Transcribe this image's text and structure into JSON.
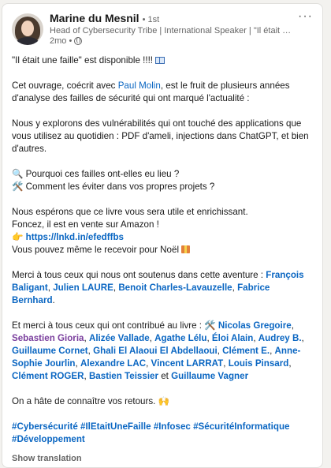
{
  "author": {
    "name": "Marine du Mesnil",
    "degree": "• 1st",
    "headline": "Head of Cybersecurity Tribe | International Speaker | \"Il était un...",
    "time": "2mo •"
  },
  "post": {
    "line1": "\"Il était une faille\" est disponible !!!! ",
    "p2_a": "Cet ouvrage, coécrit avec ",
    "p2_link": "Paul Molin",
    "p2_b": ", est le fruit de plusieurs années d'analyse des failles de sécurité qui ont marqué l'actualité :",
    "p3": "Nous y explorons des vulnérabilités qui ont touché des applications que vous utilisez au quotidien : PDF d'ameli, injections dans ChatGPT, et bien d'autres.",
    "q1": "🔍 Pourquoi ces failles ont-elles eu lieu ?",
    "q2": "🛠️ Comment les éviter dans vos propres projets ?",
    "p5_1": "Nous espérons que ce livre vous sera utile et enrichissant.",
    "p5_2": "Foncez, il est en vente sur Amazon !",
    "p5_url_prefix": "👉 ",
    "p5_url": "https://lnkd.in/efedffbs",
    "p5_3": "Vous pouvez même le recevoir pour Noël ",
    "thanks1_a": "Merci à tous ceux qui nous ont soutenus dans cette aventure : ",
    "thanks1_n1": "François Baligant",
    "thanks1_n2": "Julien LAURE",
    "thanks1_n3": "Benoit Charles-Lavauzelle",
    "thanks1_n4": "Fabrice Bernhard",
    "thanks2_a": "Et merci à tous ceux qui ont contribué au livre : 🛠️ ",
    "contributors": [
      "Nicolas Gregoire",
      "Sebastien Gioria",
      "Alizée Vallade",
      "Agathe Lélu",
      "Éloi Alain",
      "Audrey B.",
      "Guillaume Cornet",
      "Ghali El Alaoui El Abdellaoui",
      "Clément E.",
      "Anne-Sophie Jourlin",
      "Alexandre LAC",
      "Vincent LARRAT",
      "Louis Pinsard",
      "Clément ROGER",
      "Bastien Teissier",
      "Guillaume Vagner"
    ],
    "and": " et ",
    "closing": "On a hâte de connaître vos retours. 🙌",
    "hashtags": [
      "#Cybersécurité",
      "#IlEtaitUneFaille",
      "#Infosec",
      "#SécuritéInformatique",
      "#Développement"
    ]
  },
  "footer": {
    "translate": "Show translation"
  },
  "icons": {
    "more": "more-horizontal-icon",
    "visibility": "globe-icon",
    "book": "book-emoji-icon",
    "gift": "gift-emoji-icon"
  }
}
